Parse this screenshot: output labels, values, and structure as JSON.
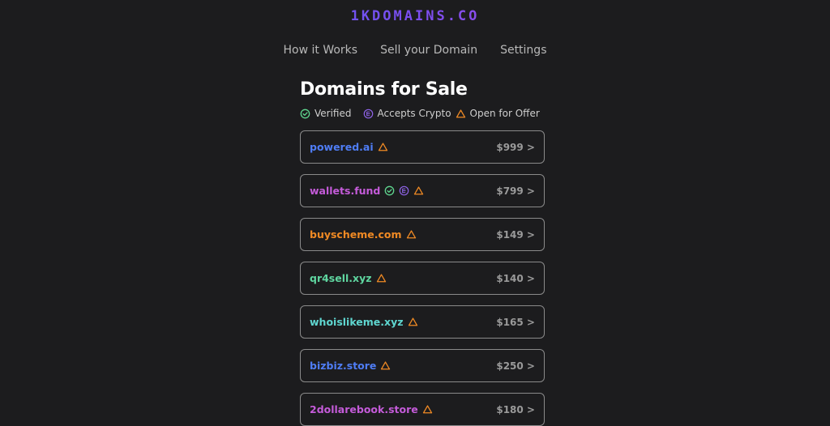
{
  "brand": {
    "logo": "1KDOMAINS.CO"
  },
  "nav": {
    "items": [
      "How it Works",
      "Sell your Domain",
      "Settings"
    ]
  },
  "main": {
    "title": "Domains for Sale",
    "legend": {
      "verified": "Verified",
      "crypto": "Accepts Crypto",
      "offer": "Open for Offer"
    }
  },
  "colors": {
    "verified": "#5fd68f",
    "crypto": "#8f63e8",
    "offer": "#f08a24",
    "border": "#8a8a8a",
    "background": "#1c1c1e"
  },
  "domains": [
    {
      "name": "powered.ai",
      "price": "$999 >",
      "color": "#4f7df5",
      "icons": [
        "offer-icon"
      ]
    },
    {
      "name": "wallets.fund",
      "price": "$799 >",
      "color": "#c45bd9",
      "icons": [
        "verified-icon",
        "crypto-icon",
        "offer-icon"
      ]
    },
    {
      "name": "buyscheme.com",
      "price": "$149 >",
      "color": "#f08a24",
      "icons": [
        "offer-icon"
      ]
    },
    {
      "name": "qr4sell.xyz",
      "price": "$140 >",
      "color": "#5fd6a0",
      "icons": [
        "offer-icon"
      ]
    },
    {
      "name": "whoislikeme.xyz",
      "price": "$165 >",
      "color": "#5fd6d0",
      "icons": [
        "offer-icon"
      ]
    },
    {
      "name": "bizbiz.store",
      "price": "$250 >",
      "color": "#4f7df5",
      "icons": [
        "offer-icon"
      ]
    },
    {
      "name": "2dollarebook.store",
      "price": "$180 >",
      "color": "#c45bd9",
      "icons": [
        "offer-icon"
      ]
    }
  ]
}
